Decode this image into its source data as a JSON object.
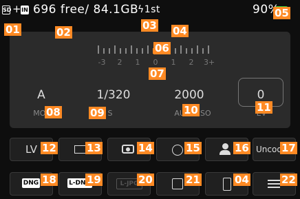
{
  "status_bar": {
    "sd_label": "SD",
    "plus": "+",
    "internal_label": "IN",
    "storage_text": "696 free/ 84.1GB",
    "flash_text": "ϟ1st",
    "battery_text": "90%"
  },
  "exposure": {
    "scale_numbers": [
      "-3",
      "2",
      "1",
      "0",
      "1",
      "2",
      "3+"
    ],
    "mode_value": "A",
    "shutter_value": "1/320",
    "iso_value": "2000",
    "ev_value": "0",
    "mode_label": "MODE",
    "shutter_label": "S",
    "iso_label": "AUTO ISO",
    "ev_label": "EV"
  },
  "buttons": {
    "lv_label": "LV",
    "uncoded_label": "Uncoded",
    "dng_label": "DNG",
    "ldng_label": "L-DNG",
    "ljpg_label": "L-JPG"
  },
  "callouts": [
    "01",
    "02",
    "03",
    "04",
    "05",
    "06",
    "07",
    "08",
    "09",
    "10",
    "11",
    "12",
    "13",
    "14",
    "15",
    "16",
    "17",
    "18",
    "19",
    "20",
    "21",
    "04",
    "22"
  ],
  "colors": {
    "accent": "#ff8a24",
    "battery": "#2ecc40",
    "panel": "#2b2b2b"
  },
  "icons": [
    "sd-card-icon",
    "internal-memory-icon",
    "flash-icon",
    "battery-icon",
    "frame-icon",
    "metering-icon",
    "stabilization-icon",
    "user-profile-icon",
    "reset-icon",
    "phone-connect-icon",
    "menu-icon"
  ]
}
